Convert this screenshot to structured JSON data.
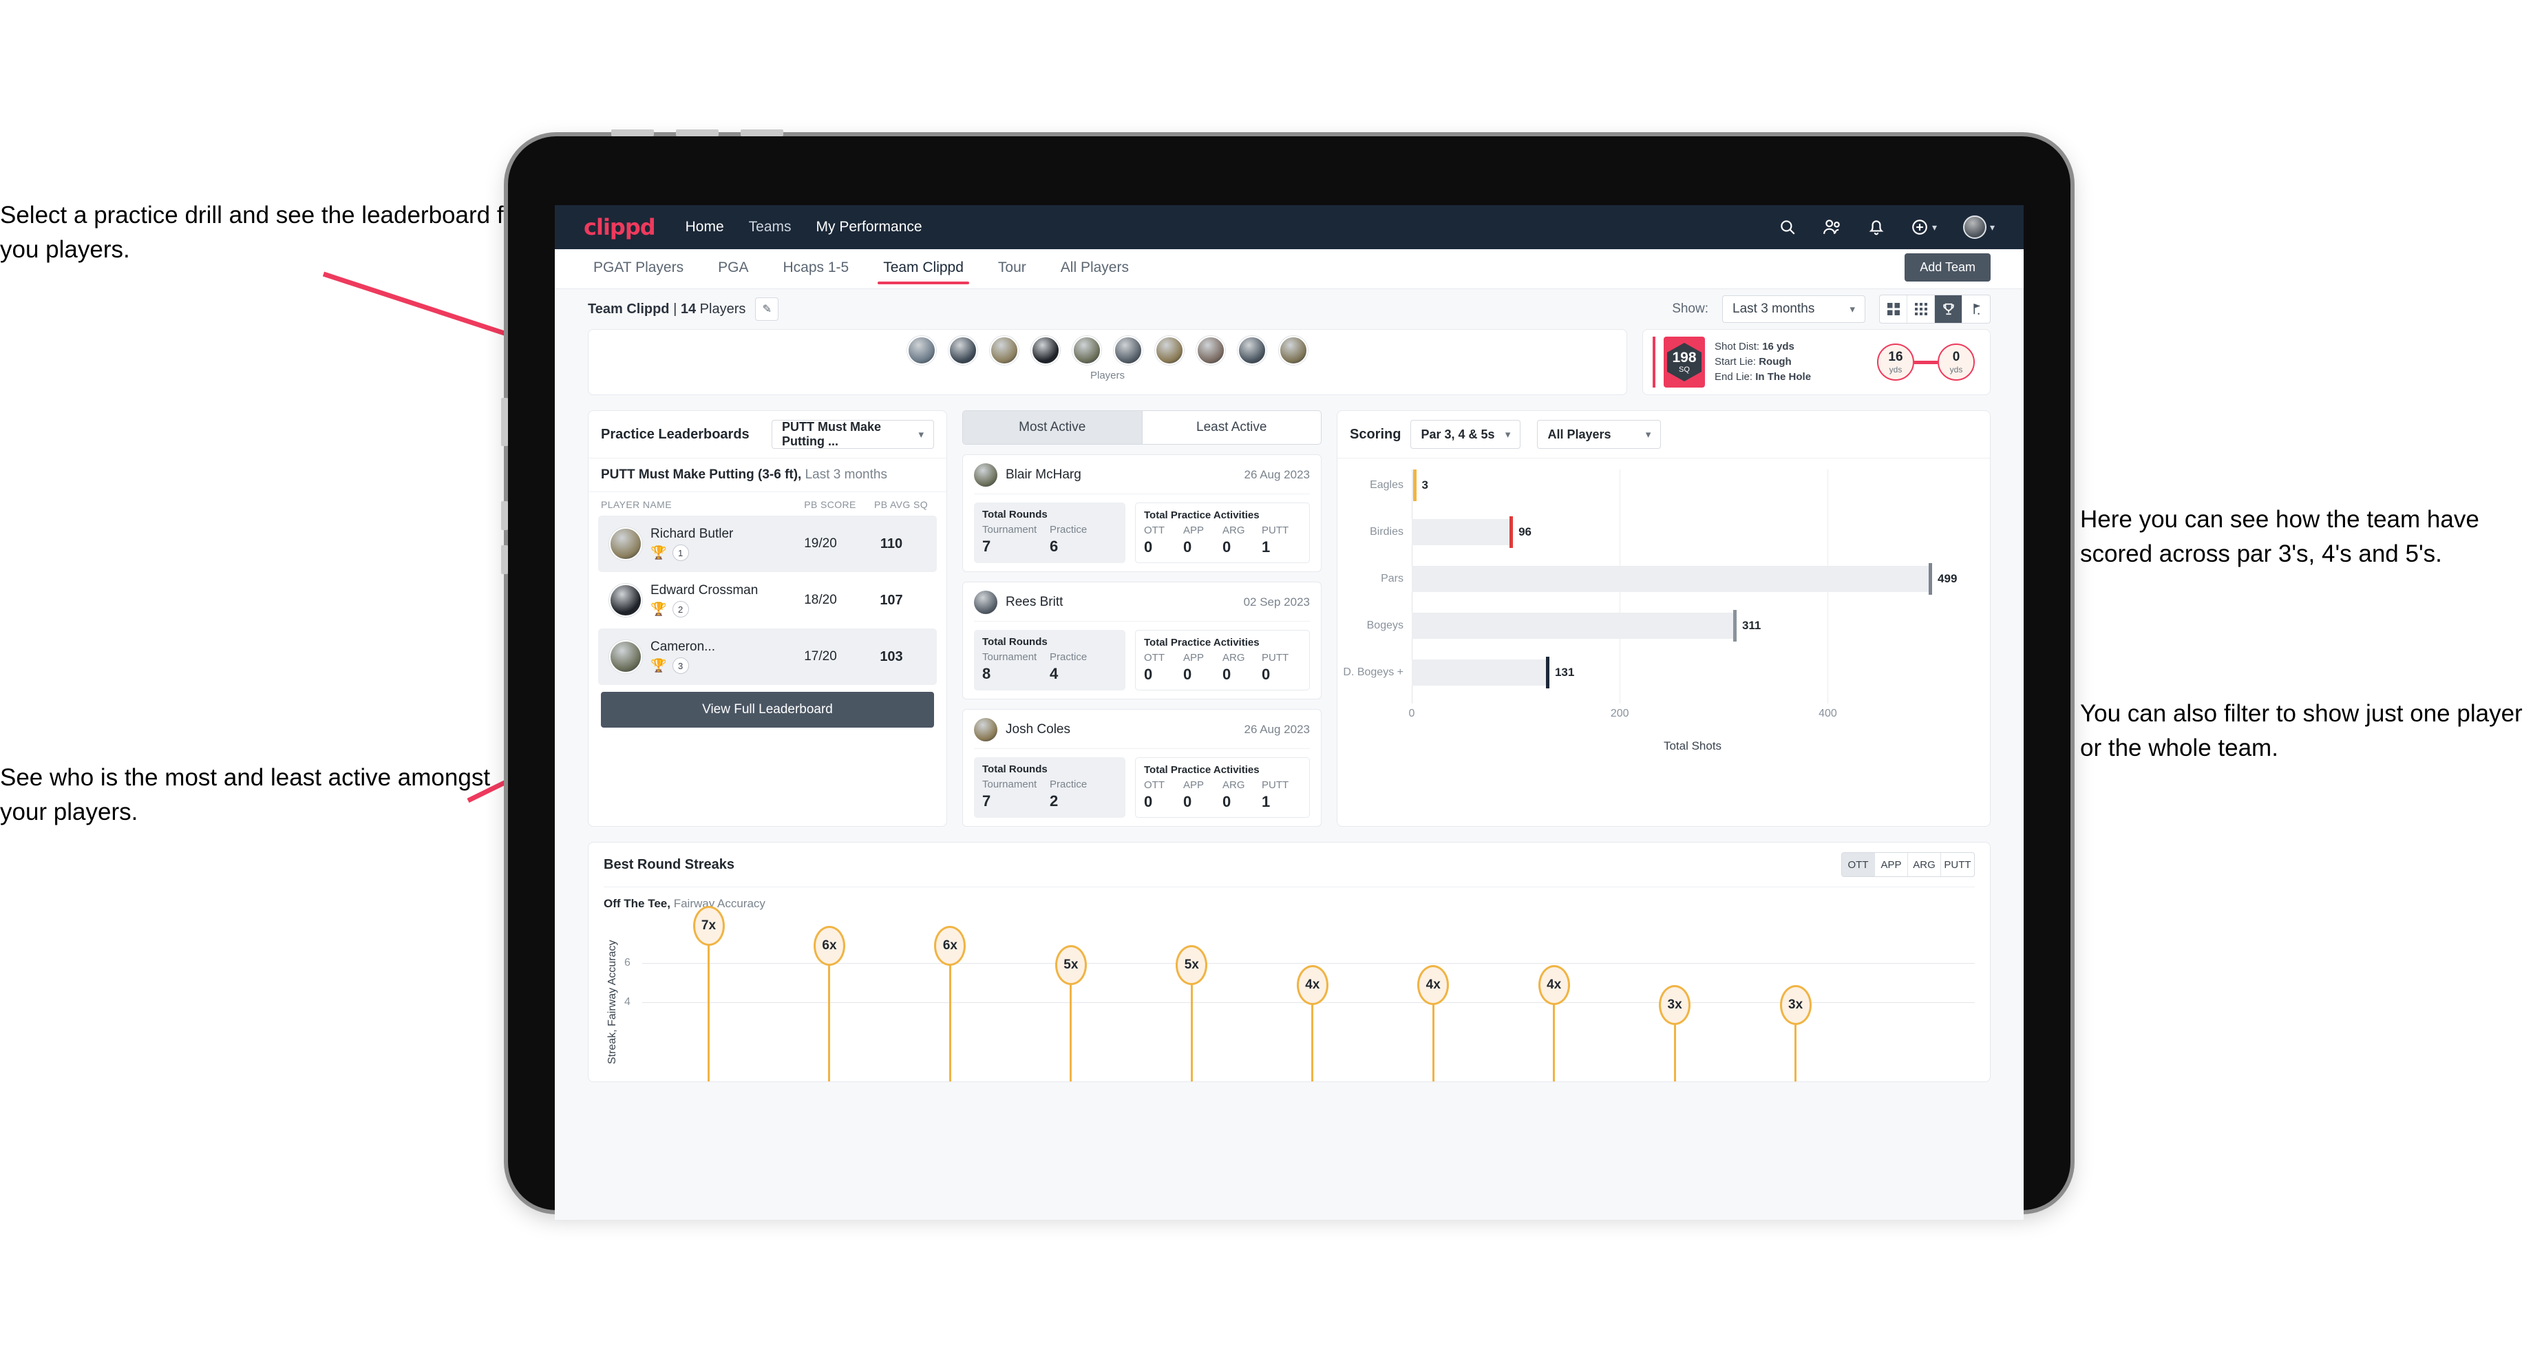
{
  "annotations": {
    "top_left": "Select a practice drill and see the leaderboard for you players.",
    "bottom_left": "See who is the most and least active amongst your players.",
    "right_1": "Here you can see how the team have scored across par 3's, 4's and 5's.",
    "right_2": "You can also filter to show just one player or the whole team."
  },
  "topnav": {
    "logo": "clippd",
    "links": [
      {
        "label": "Home",
        "active": true
      },
      {
        "label": "Teams",
        "active": false
      },
      {
        "label": "My Performance",
        "active": false
      }
    ],
    "icons": [
      "search-icon",
      "people-icon",
      "bell-icon",
      "add-circle-icon",
      "avatar"
    ]
  },
  "tabs": [
    {
      "label": "PGAT Players",
      "active": false
    },
    {
      "label": "PGA",
      "active": false
    },
    {
      "label": "Hcaps 1-5",
      "active": false
    },
    {
      "label": "Team Clippd",
      "active": true
    },
    {
      "label": "Tour",
      "active": false
    },
    {
      "label": "All Players",
      "active": false
    }
  ],
  "add_team_button": "Add Team",
  "subbar": {
    "team_name": "Team Clippd",
    "separator": "|",
    "player_count": "14",
    "players_word": "Players",
    "edit_icon": "pencil-icon",
    "show_label": "Show:",
    "show_value": "Last 3 months",
    "view_toggles": [
      {
        "icon": "grid-large-icon",
        "active": false
      },
      {
        "icon": "grid-small-icon",
        "active": false
      },
      {
        "icon": "trophy-icon",
        "active": true
      },
      {
        "icon": "flag-icon",
        "active": false
      }
    ]
  },
  "players_card": {
    "caption": "Players",
    "avatar_count": 10
  },
  "shot_card": {
    "sq_value": "198",
    "sq_unit": "SQ",
    "shot_dist_label": "Shot Dist:",
    "shot_dist_value": "16 yds",
    "start_lie_label": "Start Lie:",
    "start_lie_value": "Rough",
    "end_lie_label": "End Lie:",
    "end_lie_value": "In The Hole",
    "from_value": "16",
    "from_unit": "yds",
    "to_value": "0",
    "to_unit": "yds"
  },
  "leaderboard": {
    "title": "Practice Leaderboards",
    "drill_select": "PUTT Must Make Putting ...",
    "subtitle_bold": "PUTT Must Make Putting (3-6 ft),",
    "subtitle_light": "Last 3 months",
    "columns": [
      "PLAYER NAME",
      "PB SCORE",
      "PB AVG SQ"
    ],
    "rows": [
      {
        "name": "Richard Butler",
        "rank": "1",
        "trophy": "gold",
        "score": "19/20",
        "avg": "110"
      },
      {
        "name": "Edward Crossman",
        "rank": "2",
        "trophy": "silver",
        "score": "18/20",
        "avg": "107"
      },
      {
        "name": "Cameron...",
        "rank": "3",
        "trophy": "bronze",
        "score": "17/20",
        "avg": "103"
      }
    ],
    "button": "View Full Leaderboard"
  },
  "activity": {
    "tabs": [
      {
        "label": "Most Active",
        "active": true
      },
      {
        "label": "Least Active",
        "active": false
      }
    ],
    "rounds_title": "Total Rounds",
    "rounds_keys": [
      "Tournament",
      "Practice"
    ],
    "acts_title": "Total Practice Activities",
    "acts_keys": [
      "OTT",
      "APP",
      "ARG",
      "PUTT"
    ],
    "items": [
      {
        "name": "Blair McHarg",
        "date": "26 Aug 2023",
        "tournament": "7",
        "practice": "6",
        "ott": "0",
        "app": "0",
        "arg": "0",
        "putt": "1"
      },
      {
        "name": "Rees Britt",
        "date": "02 Sep 2023",
        "tournament": "8",
        "practice": "4",
        "ott": "0",
        "app": "0",
        "arg": "0",
        "putt": "0"
      },
      {
        "name": "Josh Coles",
        "date": "26 Aug 2023",
        "tournament": "7",
        "practice": "2",
        "ott": "0",
        "app": "0",
        "arg": "0",
        "putt": "1"
      }
    ]
  },
  "scoring": {
    "title": "Scoring",
    "filter_par": "Par 3, 4 & 5s",
    "filter_player": "All Players"
  },
  "streaks": {
    "title": "Best Round Streaks",
    "toggles": [
      {
        "label": "OTT",
        "active": true
      },
      {
        "label": "APP",
        "active": false
      },
      {
        "label": "ARG",
        "active": false
      },
      {
        "label": "PUTT",
        "active": false
      }
    ],
    "subtitle_bold": "Off The Tee,",
    "subtitle_light": "Fairway Accuracy"
  },
  "chart_data": [
    {
      "type": "bar",
      "orientation": "horizontal",
      "title": "Scoring",
      "categories": [
        "Eagles",
        "Birdies",
        "Pars",
        "Bogeys",
        "D. Bogeys +"
      ],
      "values": [
        3,
        96,
        499,
        311,
        131
      ],
      "cap_colors": [
        "#f0b444",
        "#e03a3a",
        "#7c8590",
        "#8a929b",
        "#1b2838"
      ],
      "xlabel": "Total Shots",
      "ylabel": "",
      "xlim": [
        0,
        540
      ],
      "xticks": [
        0,
        200,
        400
      ],
      "grid": true,
      "legend": "none"
    },
    {
      "type": "scatter",
      "title": "Off The Tee, Fairway Accuracy",
      "ylabel": "Streak, Fairway Accuracy",
      "xlabel": "",
      "values": [
        7,
        6,
        6,
        5,
        5,
        4,
        4,
        4,
        3,
        3
      ],
      "labels": [
        "7x",
        "6x",
        "6x",
        "5x",
        "5x",
        "4x",
        "4x",
        "4x",
        "3x",
        "3x"
      ],
      "yticks": [
        4,
        6
      ],
      "ylim": [
        0,
        8
      ],
      "grid": true
    }
  ]
}
